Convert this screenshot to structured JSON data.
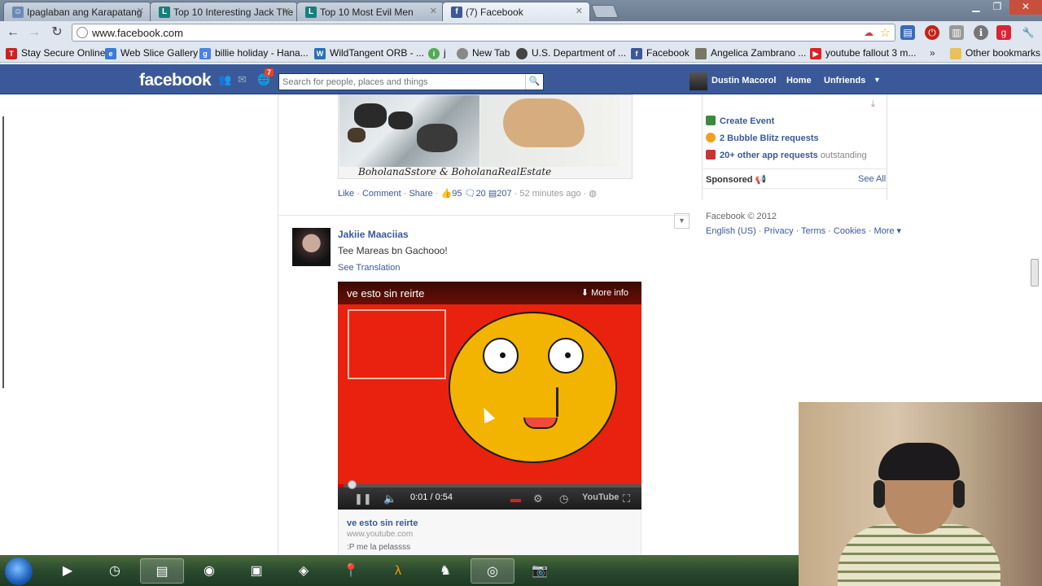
{
  "browser": {
    "tabs": [
      {
        "label": "Ipaglaban ang Karapatang",
        "icon": "person-icon"
      },
      {
        "label": "Top 10 Interesting Jack The",
        "icon": "listverse-icon"
      },
      {
        "label": "Top 10 Most Evil Men",
        "icon": "listverse-icon"
      },
      {
        "label": "(7) Facebook",
        "icon": "facebook-icon"
      }
    ],
    "url": "www.facebook.com",
    "bookmarks": [
      "Stay Secure Online",
      "Web Slice Gallery",
      "billie holiday - Hana...",
      "WildTangent ORB - ...",
      "j",
      "New Tab",
      "U.S. Department of ...",
      "Facebook",
      "Angelica Zambrano ...",
      "youtube fallout 3 m...",
      "Other bookmarks"
    ]
  },
  "facebook": {
    "logo": "facebook",
    "notification_count": "7",
    "search_placeholder": "Search for people, places and things",
    "user_name": "Dustin Macorol",
    "nav_home": "Home",
    "nav_unfriends": "Unfriends"
  },
  "post_prev": {
    "caption": "BoholanaSstore & BoholanaRealEstate",
    "like": "Like",
    "comment": "Comment",
    "share": "Share",
    "likes": "95",
    "shares": "20",
    "comments": "207",
    "time": "52 minutes ago"
  },
  "post": {
    "author": "Jakiie Maaciias",
    "message": "Tee Mareas bn Gachooo!",
    "see_translation": "See Translation",
    "video": {
      "title": "ve esto sin reirte",
      "more_info": "More info",
      "time": "0:01 / 0:54",
      "progress": 0.02
    },
    "link": {
      "title": "ve esto sin reirte",
      "url": "www.youtube.com",
      "desc": ":P me la pelassss"
    }
  },
  "sidebar": {
    "create_event": "Create Event",
    "bubble": "2 Bubble Blitz requests",
    "app_requests": "20+ other app requests",
    "outstanding": "outstanding",
    "sponsored": "Sponsored",
    "see_all": "See All",
    "copyright": "Facebook © 2012",
    "footer_links": [
      "English (US)",
      "Privacy",
      "Terms",
      "Cookies",
      "More"
    ]
  }
}
